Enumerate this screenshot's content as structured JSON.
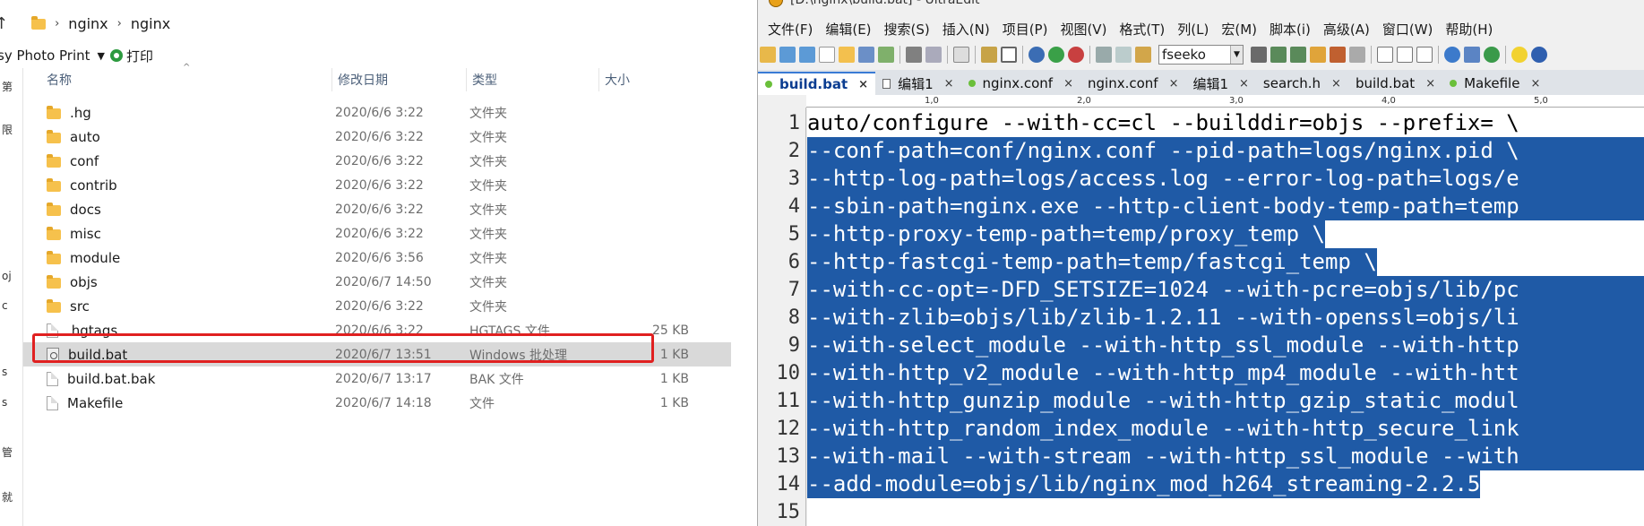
{
  "explorer": {
    "breadcrumb": [
      "nginx",
      "nginx"
    ],
    "cmdbar": {
      "left_text": "sy Photo Print",
      "print_label": "打印"
    },
    "sidepane_chars": [
      "第",
      "限",
      "oj",
      "c",
      "s",
      "s",
      "管",
      "就"
    ],
    "columns": {
      "name": "名称",
      "date": "修改日期",
      "type": "类型",
      "size": "大小"
    },
    "rows": [
      {
        "name": ".hg",
        "date": "2020/6/6 3:22",
        "type": "文件夹",
        "size": "",
        "kind": "folder"
      },
      {
        "name": "auto",
        "date": "2020/6/6 3:22",
        "type": "文件夹",
        "size": "",
        "kind": "folder"
      },
      {
        "name": "conf",
        "date": "2020/6/6 3:22",
        "type": "文件夹",
        "size": "",
        "kind": "folder"
      },
      {
        "name": "contrib",
        "date": "2020/6/6 3:22",
        "type": "文件夹",
        "size": "",
        "kind": "folder"
      },
      {
        "name": "docs",
        "date": "2020/6/6 3:22",
        "type": "文件夹",
        "size": "",
        "kind": "folder"
      },
      {
        "name": "misc",
        "date": "2020/6/6 3:22",
        "type": "文件夹",
        "size": "",
        "kind": "folder"
      },
      {
        "name": "module",
        "date": "2020/6/6 3:56",
        "type": "文件夹",
        "size": "",
        "kind": "folder"
      },
      {
        "name": "objs",
        "date": "2020/6/7 14:50",
        "type": "文件夹",
        "size": "",
        "kind": "folder"
      },
      {
        "name": "src",
        "date": "2020/6/6 3:22",
        "type": "文件夹",
        "size": "",
        "kind": "folder"
      },
      {
        "name": ".hgtags",
        "date": "2020/6/6 3:22",
        "type": "HGTAGS 文件",
        "size": "25 KB",
        "kind": "file"
      },
      {
        "name": "build.bat",
        "date": "2020/6/7 13:51",
        "type": "Windows 批处理",
        "size": "1 KB",
        "kind": "bat",
        "selected": true
      },
      {
        "name": "build.bat.bak",
        "date": "2020/6/7 13:17",
        "type": "BAK 文件",
        "size": "1 KB",
        "kind": "file"
      },
      {
        "name": "Makefile",
        "date": "2020/6/7 14:18",
        "type": "文件",
        "size": "1 KB",
        "kind": "file"
      }
    ]
  },
  "editor": {
    "title": "[D:\\nginx\\build.bat] - UltraEdit",
    "menu": [
      "文件(F)",
      "编辑(E)",
      "搜索(S)",
      "插入(N)",
      "项目(P)",
      "视图(V)",
      "格式(T)",
      "列(L)",
      "宏(M)",
      "脚本(i)",
      "高级(A)",
      "窗口(W)",
      "帮助(H)"
    ],
    "search_combo": "fseeko",
    "tabs": [
      {
        "label": "build.bat",
        "active": true,
        "icon": "dot"
      },
      {
        "label": "编辑1",
        "active": false,
        "icon": "page"
      },
      {
        "label": "nginx.conf",
        "active": false,
        "icon": "dot"
      },
      {
        "label": "nginx.conf",
        "active": false,
        "icon": "none"
      },
      {
        "label": "编辑1",
        "active": false,
        "icon": "none"
      },
      {
        "label": "search.h",
        "active": false,
        "icon": "none"
      },
      {
        "label": "build.bat",
        "active": false,
        "icon": "none"
      },
      {
        "label": "Makefile",
        "active": false,
        "icon": "dot"
      }
    ],
    "ruler": [
      "1,0",
      "2,0",
      "3,0",
      "4,0",
      "5,0"
    ],
    "lines": [
      "auto/configure --with-cc=cl --builddir=objs --prefix= \\",
      "--conf-path=conf/nginx.conf --pid-path=logs/nginx.pid \\",
      "--http-log-path=logs/access.log --error-log-path=logs/e",
      "--sbin-path=nginx.exe --http-client-body-temp-path=temp",
      "--http-proxy-temp-path=temp/proxy_temp \\",
      "--http-fastcgi-temp-path=temp/fastcgi_temp \\",
      "--with-cc-opt=-DFD_SETSIZE=1024 --with-pcre=objs/lib/pc",
      "--with-zlib=objs/lib/zlib-1.2.11 --with-openssl=objs/li",
      "--with-select_module --with-http_ssl_module --with-http",
      "--with-http_v2_module --with-http_mp4_module --with-htt",
      "--with-http_gunzip_module --with-http_gzip_static_modul",
      "--with-http_random_index_module --with-http_secure_link",
      "--with-mail --with-stream --with-http_ssl_module --with",
      "--add-module=objs/lib/nginx_mod_h264_streaming-2.2.5",
      ""
    ],
    "line_numbers": [
      "1",
      "2",
      "3",
      "4",
      "5",
      "6",
      "7",
      "8",
      "9",
      "10",
      "11",
      "12",
      "13",
      "14",
      "15"
    ]
  }
}
